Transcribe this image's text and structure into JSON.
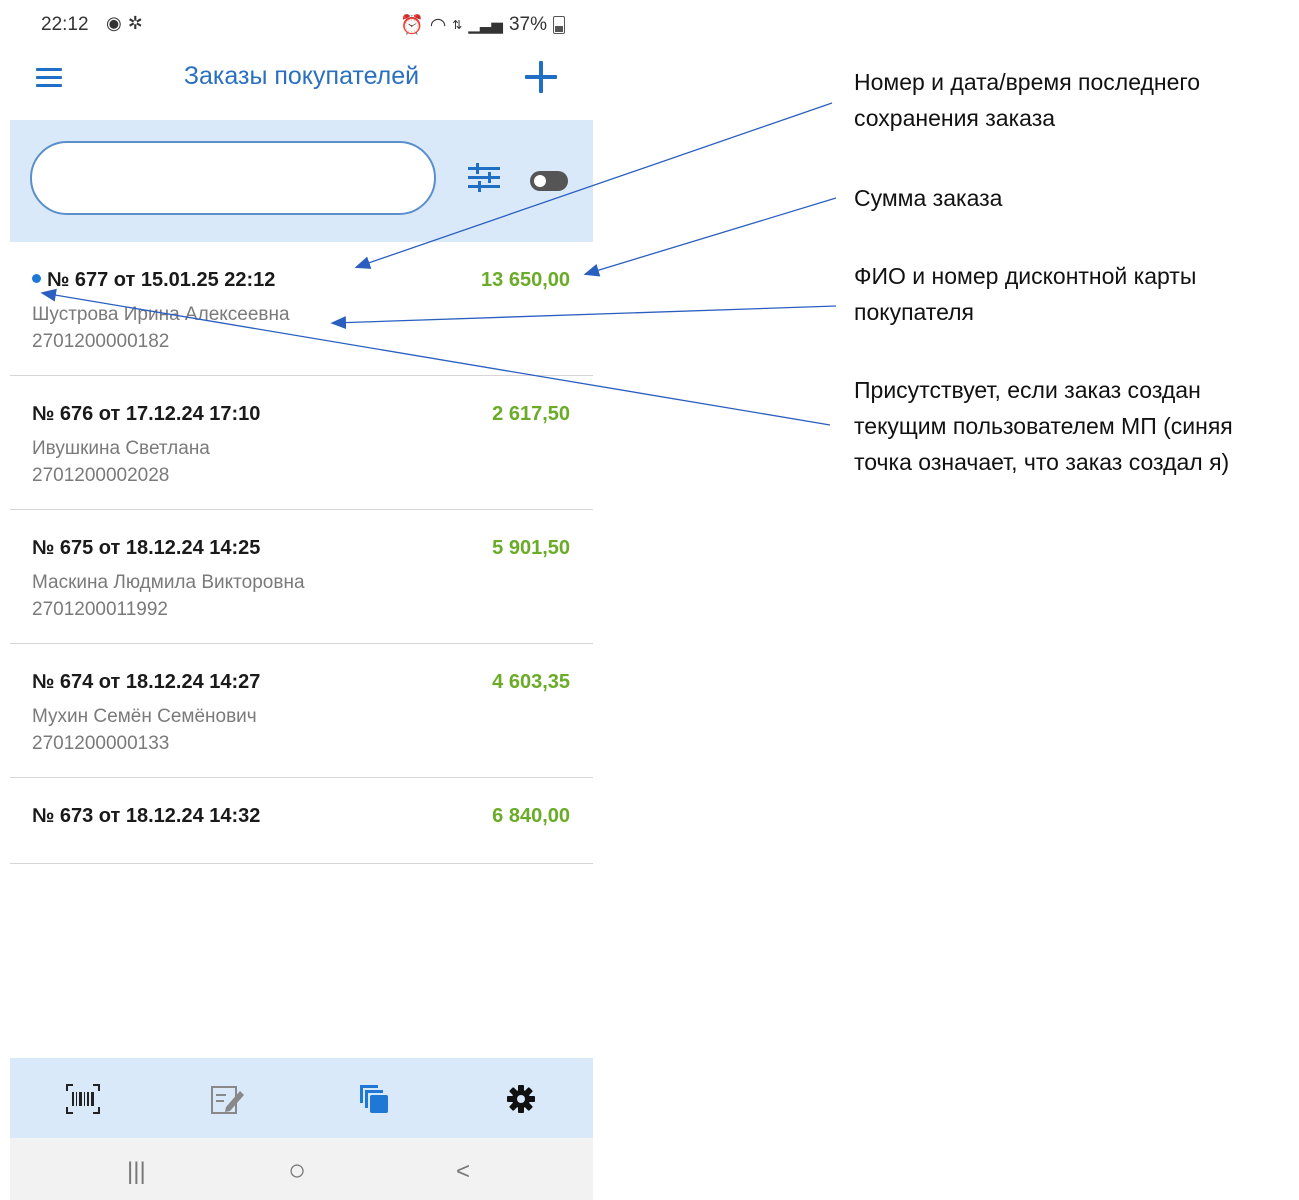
{
  "status_bar": {
    "time": "22:12",
    "battery": "37%",
    "left_icons": [
      "whatsapp-icon",
      "settings-icon"
    ],
    "right_icons": [
      "alarm-icon",
      "wifi-icon",
      "data-icon",
      "signal-icon",
      "battery-icon"
    ]
  },
  "app_bar": {
    "title": "Заказы покупателей",
    "menu_icon": "hamburger-menu-icon",
    "add_icon": "plus-icon"
  },
  "search": {
    "value": "",
    "placeholder": "",
    "filter_icon": "filter-sliders-icon",
    "toggle_state": "off"
  },
  "orders": [
    {
      "title": "№ 677 от 15.01.25 22:12",
      "amount": "13 650,00",
      "customer": "Шустрова Ирина Алексеевна",
      "card": "2701200000182",
      "own_dot": true
    },
    {
      "title": "№ 676 от 17.12.24 17:10",
      "amount": "2 617,50",
      "customer": "Ивушкина Светлана",
      "card": "2701200002028",
      "own_dot": false
    },
    {
      "title": "№ 675 от 18.12.24 14:25",
      "amount": "5 901,50",
      "customer": "Маскина Людмила Викторовна",
      "card": "2701200011992",
      "own_dot": false
    },
    {
      "title": "№ 674 от 18.12.24 14:27",
      "amount": "4 603,35",
      "customer": "Мухин Семён Семёнович",
      "card": "2701200000133",
      "own_dot": false
    },
    {
      "title": "№ 673 от 18.12.24 14:32",
      "amount": "6 840,00",
      "customer": "",
      "card": "",
      "own_dot": false
    }
  ],
  "bottom_nav": [
    "barcode-scanner-icon",
    "edit-note-icon",
    "copy-stack-icon",
    "settings-gear-icon"
  ],
  "system_nav": {
    "recents": "|||",
    "home": "○",
    "back": "<"
  },
  "annotations": [
    {
      "text": "Номер и дата/время последнего сохранения заказа"
    },
    {
      "text": "Сумма заказа"
    },
    {
      "text": "ФИО и номер дисконтной карты покупателя"
    },
    {
      "text": "Присутствует, если заказ создан текущим пользователем МП (синяя точка означает, что заказ создал я)"
    }
  ],
  "colors": {
    "accent": "#1f6fc4",
    "panel": "#d9e9fa",
    "amount": "#6aab27",
    "dot": "#1f78d6"
  }
}
